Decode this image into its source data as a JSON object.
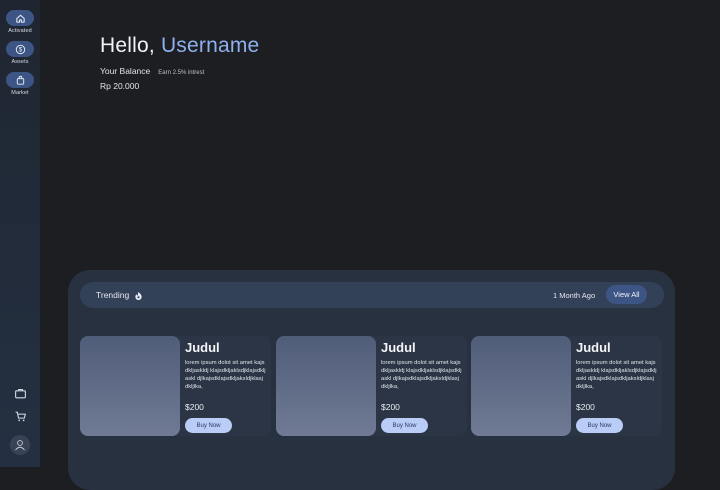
{
  "sidebar": {
    "items": [
      {
        "label": "Activated",
        "icon": "home-icon"
      },
      {
        "label": "Assets",
        "icon": "dollar-icon"
      },
      {
        "label": "Market",
        "icon": "shopping-bag-icon"
      }
    ],
    "bottom_icons": [
      "briefcase-icon",
      "cart-icon"
    ],
    "avatar_icon": "avatar"
  },
  "header": {
    "greeting": "Hello,",
    "username": "Username",
    "balance_label": "Your Balance",
    "interest": "Earn 2.5% intrest",
    "balance_amount": "Rp 20.000"
  },
  "trending": {
    "title": "Trending",
    "icon": "fire-icon",
    "time": "1 Month Ago",
    "view_all": "View All"
  },
  "cards": [
    {
      "title": "Judul",
      "description": "lorem ipsum dolot sit amet kajsdkljaskldj klajsdkljaklsdjklajsdkljaskl djlkajsdklajsdkljaksldjklasj dkljlka,",
      "price": "$200",
      "button": "Buy Now"
    },
    {
      "title": "Judul",
      "description": "lorem ipsum dolot sit amet kajsdkljaskldj klajsdkljaklsdjklajsdkljaskl djlkajsdklajsdkljaksldjklasj dkljlka,",
      "price": "$200",
      "button": "Buy Now"
    },
    {
      "title": "Judul",
      "description": "lorem ipsum dolot sit amet kajsdkljaskldj klajsdkljaklsdjklajsdkljaskl djlkajsdklajsdkljaksldjklasj dkljlka,",
      "price": "$200",
      "button": "Buy Now"
    }
  ],
  "colors": {
    "background": "#1c1e22",
    "sidebar": "#243042",
    "accent": "#3d5584",
    "username": "#8fb0ec",
    "button": "#b9cdf7"
  }
}
